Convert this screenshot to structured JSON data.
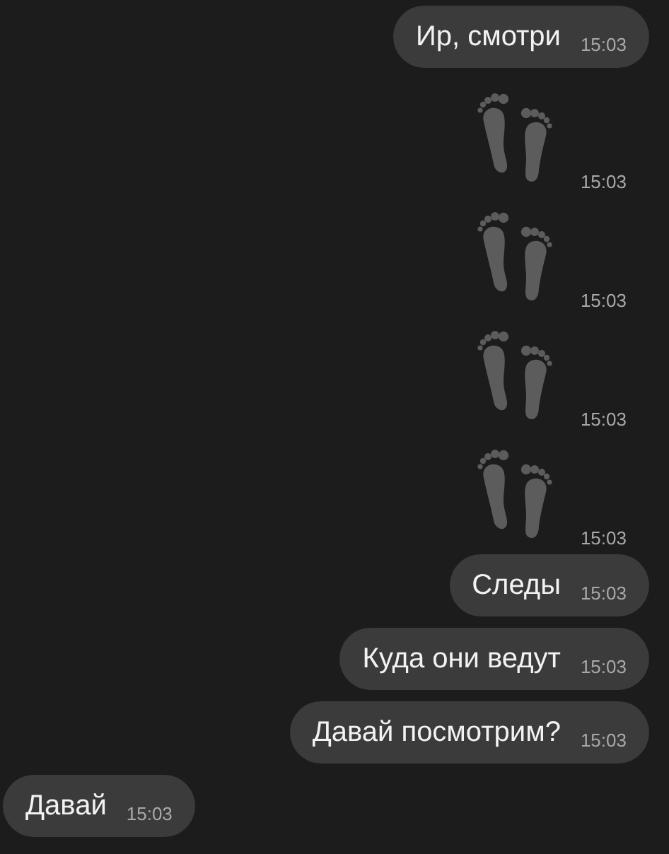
{
  "messages": [
    {
      "kind": "text",
      "outgoing": true,
      "text": "Ир, смотри",
      "time": "15:03"
    },
    {
      "kind": "footprints",
      "outgoing": true,
      "time": "15:03"
    },
    {
      "kind": "footprints",
      "outgoing": true,
      "time": "15:03"
    },
    {
      "kind": "footprints",
      "outgoing": true,
      "time": "15:03"
    },
    {
      "kind": "footprints",
      "outgoing": true,
      "time": "15:03"
    },
    {
      "kind": "text",
      "outgoing": true,
      "text": "Следы",
      "time": "15:03"
    },
    {
      "kind": "text",
      "outgoing": true,
      "text": "Куда они ведут",
      "time": "15:03"
    },
    {
      "kind": "text",
      "outgoing": true,
      "text": "Давай посмотрим?",
      "time": "15:03"
    },
    {
      "kind": "text",
      "outgoing": false,
      "text": "Давай",
      "time": "15:03"
    }
  ]
}
